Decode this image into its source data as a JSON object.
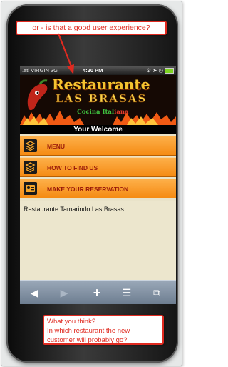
{
  "callout_top": {
    "text": "or - is that a good user experience?"
  },
  "callout_bottom": {
    "lines": [
      "What you think?",
      "In which restaurant the new",
      "customer will probably go?"
    ]
  },
  "status_bar": {
    "signal": ".atl VIRGIN 3G",
    "time": "4:20 PM",
    "icons": "⚙ ➤ ◷"
  },
  "header": {
    "title_line1": "Restaurante",
    "title_line2": "LAS BRASAS",
    "cocina": "Cocina",
    "italiana_part1": "Ital",
    "italiana_part2": "iana",
    "welcome": "Your Welcome"
  },
  "menu": {
    "items": [
      {
        "label": "MENU",
        "icon": "stack-icon"
      },
      {
        "label": "HOW TO FIND US",
        "icon": "stack-icon"
      },
      {
        "label": "MAKE YOUR RESERVATION",
        "icon": "id-card-icon"
      }
    ]
  },
  "content": {
    "text": "Restaurante Tamarindo Las Brasas"
  },
  "toolbar": {
    "back": "◀",
    "forward": "▶",
    "add": "+",
    "bookmarks": "☰",
    "pages": "⧉"
  },
  "colors": {
    "callout_border": "#e02a20",
    "menu_bar": "#f7931e",
    "menu_text": "#9b1b0a",
    "content_bg": "#ece6cd",
    "toolbar": "#7f8fa2"
  }
}
